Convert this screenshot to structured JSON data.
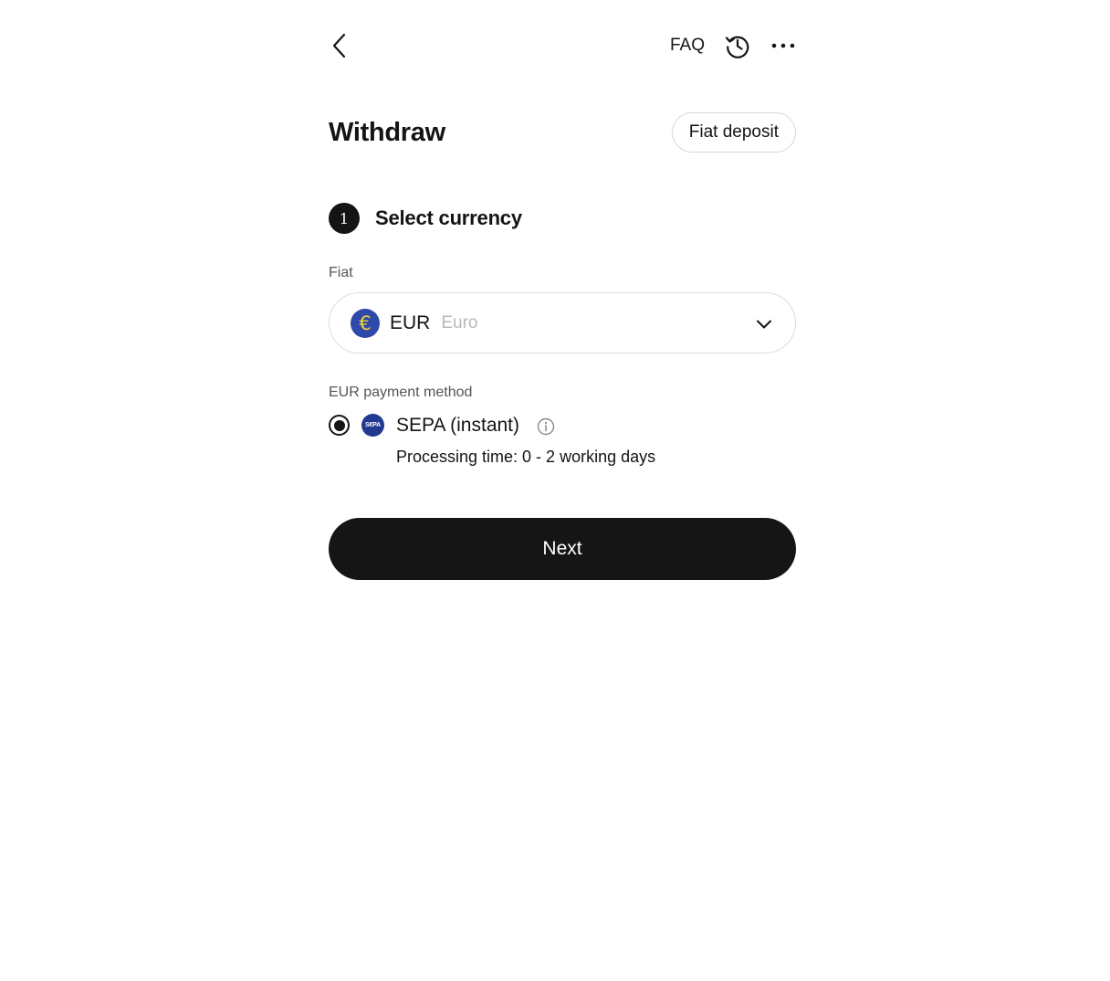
{
  "header": {
    "faq_label": "FAQ"
  },
  "title": "Withdraw",
  "fiat_deposit_label": "Fiat deposit",
  "step": {
    "number": "1",
    "title": "Select currency"
  },
  "fiat_section": {
    "label": "Fiat",
    "selected_code": "EUR",
    "selected_name": "Euro",
    "currency_symbol": "€"
  },
  "payment_method": {
    "label": "EUR payment method",
    "option_name": "SEPA (instant)",
    "option_logo_text": "S€PA",
    "processing_time": "Processing time: 0 - 2 working days"
  },
  "next_label": "Next",
  "colors": {
    "primary_button": "#151515",
    "euro_badge": "#2f49a8",
    "sepa_badge": "#213a8f"
  }
}
